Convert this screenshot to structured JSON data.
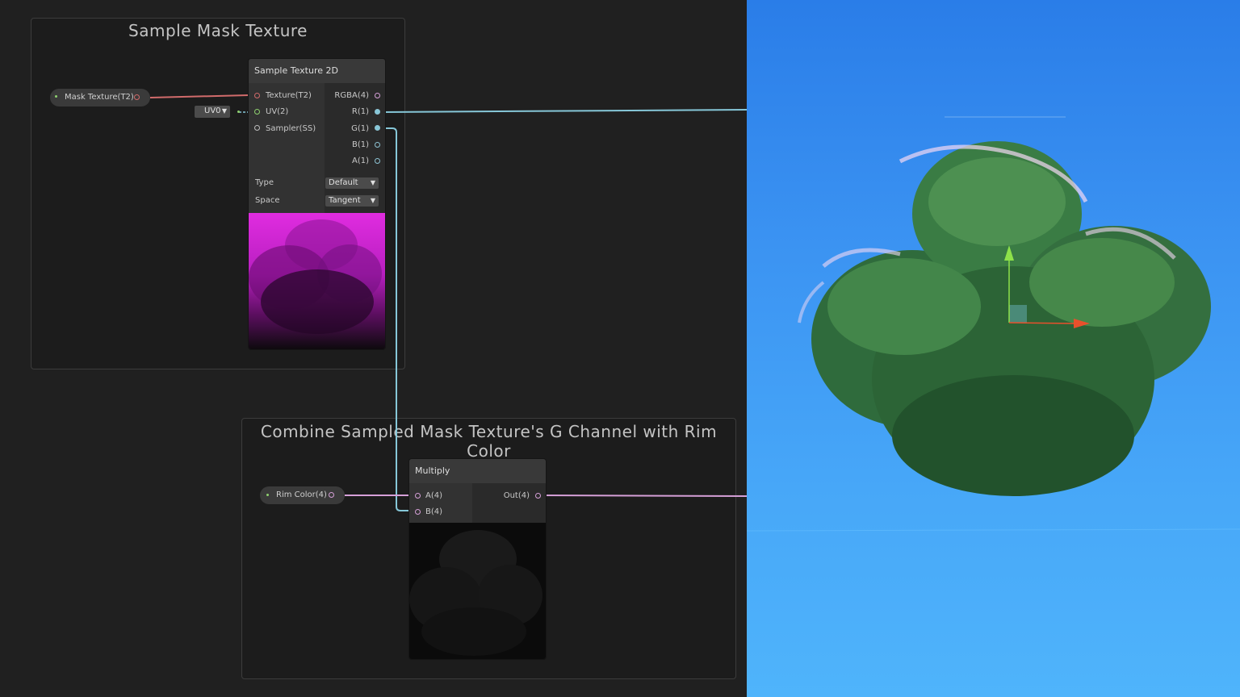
{
  "groups": {
    "sample": {
      "title": "Sample Mask Texture"
    },
    "combine": {
      "title": "Combine Sampled Mask Texture's G Channel with Rim Color"
    }
  },
  "properties": {
    "mask_texture": {
      "label": "Mask Texture(T2)"
    },
    "rim_color": {
      "label": "Rim Color(4)"
    }
  },
  "uv_dropdown": {
    "value": "UV0"
  },
  "sample_node": {
    "title": "Sample Texture 2D",
    "inputs": [
      "Texture(T2)",
      "UV(2)",
      "Sampler(SS)"
    ],
    "outputs": [
      "RGBA(4)",
      "R(1)",
      "G(1)",
      "B(1)",
      "A(1)"
    ],
    "type_label": "Type",
    "type_value": "Default",
    "space_label": "Space",
    "space_value": "Tangent"
  },
  "multiply_node": {
    "title": "Multiply",
    "inputs": [
      "A(4)",
      "B(4)"
    ],
    "outputs": [
      "Out(4)"
    ]
  },
  "colors": {
    "graph_bg": "#202020",
    "wire_texture": "#d16b6b",
    "wire_float": "#86c7d8",
    "wire_color": "#d6a0d8",
    "sky_top": "#2a7de8",
    "sky_bottom": "#4fb4fb"
  },
  "icons": {
    "uv_arrow": "caret-down-icon",
    "gizmo_y": "up-arrow-icon",
    "gizmo_x": "right-arrow-icon"
  }
}
